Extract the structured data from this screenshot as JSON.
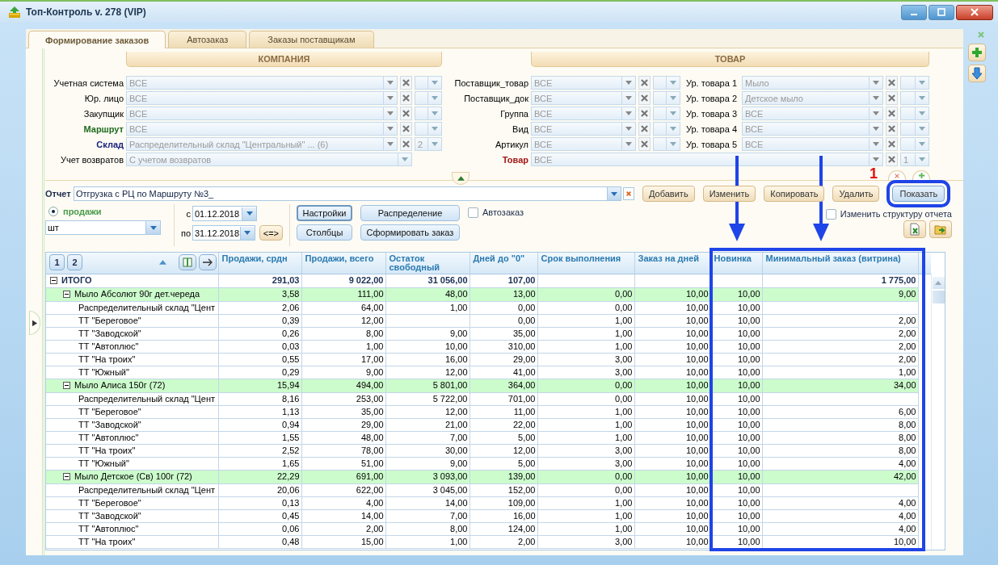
{
  "window": {
    "title": "Топ-Контроль v. 278 (VIP)"
  },
  "tabs": [
    {
      "label": "Формирование заказов",
      "selected": true
    },
    {
      "label": "Автозаказ",
      "selected": false
    },
    {
      "label": "Заказы поставщикам",
      "selected": false
    }
  ],
  "section_headers": [
    "КОМПАНИЯ",
    "ТОВАР"
  ],
  "company_filters": [
    {
      "label": "Учетная система",
      "color": "#000000",
      "value": "ВСЕ",
      "kind": "filter"
    },
    {
      "label": "Юр. лицо",
      "color": "#000000",
      "value": "ВСЕ",
      "kind": "filter"
    },
    {
      "label": "Закупщик",
      "color": "#000000",
      "value": "ВСЕ",
      "kind": "filter"
    },
    {
      "label": "Маршрут",
      "color": "#1e6b1e",
      "value": "ВСЕ",
      "kind": "filter"
    },
    {
      "label": "Склад",
      "color": "#1a237e",
      "value": "Распределительный склад \"Центральный\" ... (6)",
      "kind": "filter",
      "extra": "2"
    },
    {
      "label": "Учет возвратов",
      "color": "#000000",
      "value": "С учетом возвратов",
      "kind": "wide"
    }
  ],
  "supplier_filters": [
    {
      "label": "Поставщик_товар",
      "value": "ВСЕ"
    },
    {
      "label": "Поставщик_док",
      "value": "ВСЕ"
    },
    {
      "label": "Группа",
      "value": "ВСЕ"
    },
    {
      "label": "Вид",
      "value": "ВСЕ"
    },
    {
      "label": "Артикул",
      "value": "ВСЕ"
    }
  ],
  "product_levels": [
    {
      "label": "Ур. товара 1",
      "value": "Мыло"
    },
    {
      "label": "Ур. товара 2",
      "value": "Детское мыло"
    },
    {
      "label": "Ур. товара 3",
      "value": "ВСЕ"
    },
    {
      "label": "Ур. товара 4",
      "value": "ВСЕ"
    },
    {
      "label": "Ур. товара 5",
      "value": "ВСЕ"
    }
  ],
  "goods_filter": {
    "label": "Товар",
    "value": "ВСЕ",
    "extra": "1"
  },
  "report": {
    "label": "Отчет",
    "value": "Отгрузка с РЦ по Маршруту №3_"
  },
  "report_buttons": [
    {
      "label": "Добавить",
      "highlighted": false
    },
    {
      "label": "Изменить",
      "highlighted": false
    },
    {
      "label": "Копировать",
      "highlighted": false
    },
    {
      "label": "Удалить",
      "highlighted": false
    },
    {
      "label": "Показать",
      "highlighted": true
    }
  ],
  "mode": {
    "label": "продажи",
    "selected": true
  },
  "unit": "шт",
  "date_from": {
    "label": "с",
    "value": "01.12.2018"
  },
  "date_to": {
    "label": "по",
    "value": "31.12.2018"
  },
  "swap_button": "<=>",
  "action_buttons": [
    {
      "label": "Настройки",
      "pressed": true
    },
    {
      "label": "Распределение",
      "pressed": false
    },
    {
      "label": "Столбцы",
      "pressed": false
    },
    {
      "label": "Сформировать заказ",
      "pressed": false
    }
  ],
  "autoorder": {
    "label": "Автозаказ",
    "checked": false
  },
  "change_structure": {
    "label": "Изменить структуру отчета",
    "checked": false
  },
  "annotation_marker": "1",
  "table": {
    "view_buttons": [
      "1",
      "2"
    ],
    "columns": [
      "",
      "Продажи, срдн",
      "Продажи, всего",
      "Остаток свободный",
      "Дней до \"0\"",
      "Срок выполнения",
      "Заказ на дней",
      "Новинка",
      "Минимальный заказ (витрина)"
    ],
    "rows": [
      {
        "kind": "total",
        "expanded": true,
        "cells": [
          "ИТОГО",
          "291,03",
          "9 022,00",
          "31 056,00",
          "107,00",
          "",
          "",
          "",
          "1 775,00"
        ],
        "children": [
          {
            "kind": "group",
            "expanded": true,
            "cells": [
              "Мыло Абсолют 90г дет.череда",
              "3,58",
              "111,00",
              "48,00",
              "13,00",
              "0,00",
              "10,00",
              "10,00",
              "9,00"
            ],
            "children": [
              {
                "kind": "item",
                "cells": [
                  "Распределительный склад \"Цент",
                  "2,06",
                  "64,00",
                  "1,00",
                  "0,00",
                  "0,00",
                  "10,00",
                  "10,00",
                  ""
                ]
              },
              {
                "kind": "item",
                "cells": [
                  "ТТ  \"Береговое\"",
                  "0,39",
                  "12,00",
                  "",
                  "0,00",
                  "1,00",
                  "10,00",
                  "10,00",
                  "2,00"
                ]
              },
              {
                "kind": "item",
                "cells": [
                  "ТТ  \"Заводской\"",
                  "0,26",
                  "8,00",
                  "9,00",
                  "35,00",
                  "1,00",
                  "10,00",
                  "10,00",
                  "2,00"
                ]
              },
              {
                "kind": "item",
                "cells": [
                  "ТТ \"Автоплюс\"",
                  "0,03",
                  "1,00",
                  "10,00",
                  "310,00",
                  "1,00",
                  "10,00",
                  "10,00",
                  "2,00"
                ]
              },
              {
                "kind": "item",
                "cells": [
                  "ТТ \"На троих\"",
                  "0,55",
                  "17,00",
                  "16,00",
                  "29,00",
                  "3,00",
                  "10,00",
                  "10,00",
                  "2,00"
                ]
              },
              {
                "kind": "item",
                "cells": [
                  "ТТ \"Южный\"",
                  "0,29",
                  "9,00",
                  "12,00",
                  "41,00",
                  "3,00",
                  "10,00",
                  "10,00",
                  "1,00"
                ]
              }
            ]
          },
          {
            "kind": "group",
            "expanded": true,
            "cells": [
              "Мыло Алиса 150г (72)",
              "15,94",
              "494,00",
              "5 801,00",
              "364,00",
              "0,00",
              "10,00",
              "10,00",
              "34,00"
            ],
            "children": [
              {
                "kind": "item",
                "cells": [
                  "Распределительный склад \"Цент",
                  "8,16",
                  "253,00",
                  "5 722,00",
                  "701,00",
                  "0,00",
                  "10,00",
                  "10,00",
                  ""
                ]
              },
              {
                "kind": "item",
                "cells": [
                  "ТТ  \"Береговое\"",
                  "1,13",
                  "35,00",
                  "12,00",
                  "11,00",
                  "1,00",
                  "10,00",
                  "10,00",
                  "6,00"
                ]
              },
              {
                "kind": "item",
                "cells": [
                  "ТТ  \"Заводской\"",
                  "0,94",
                  "29,00",
                  "21,00",
                  "22,00",
                  "1,00",
                  "10,00",
                  "10,00",
                  "8,00"
                ]
              },
              {
                "kind": "item",
                "cells": [
                  "ТТ \"Автоплюс\"",
                  "1,55",
                  "48,00",
                  "7,00",
                  "5,00",
                  "1,00",
                  "10,00",
                  "10,00",
                  "8,00"
                ]
              },
              {
                "kind": "item",
                "cells": [
                  "ТТ \"На троих\"",
                  "2,52",
                  "78,00",
                  "30,00",
                  "12,00",
                  "3,00",
                  "10,00",
                  "10,00",
                  "8,00"
                ]
              },
              {
                "kind": "item",
                "cells": [
                  "ТТ \"Южный\"",
                  "1,65",
                  "51,00",
                  "9,00",
                  "5,00",
                  "3,00",
                  "10,00",
                  "10,00",
                  "4,00"
                ]
              }
            ]
          },
          {
            "kind": "group",
            "expanded": true,
            "cells": [
              "Мыло Детское (Св) 100г (72)",
              "22,29",
              "691,00",
              "3 093,00",
              "139,00",
              "0,00",
              "10,00",
              "10,00",
              "42,00"
            ],
            "children": [
              {
                "kind": "item",
                "cells": [
                  "Распределительный склад \"Цент",
                  "20,06",
                  "622,00",
                  "3 045,00",
                  "152,00",
                  "0,00",
                  "10,00",
                  "10,00",
                  ""
                ]
              },
              {
                "kind": "item",
                "cells": [
                  "ТТ  \"Береговое\"",
                  "0,13",
                  "4,00",
                  "14,00",
                  "109,00",
                  "1,00",
                  "10,00",
                  "10,00",
                  "4,00"
                ]
              },
              {
                "kind": "item",
                "cells": [
                  "ТТ  \"Заводской\"",
                  "0,45",
                  "14,00",
                  "7,00",
                  "16,00",
                  "1,00",
                  "10,00",
                  "10,00",
                  "4,00"
                ]
              },
              {
                "kind": "item",
                "cells": [
                  "ТТ \"Автоплюс\"",
                  "0,06",
                  "2,00",
                  "8,00",
                  "124,00",
                  "1,00",
                  "10,00",
                  "10,00",
                  "4,00"
                ]
              },
              {
                "kind": "item",
                "cells": [
                  "ТТ \"На троих\"",
                  "0,48",
                  "15,00",
                  "1,00",
                  "2,00",
                  "3,00",
                  "10,00",
                  "10,00",
                  "10,00"
                ]
              }
            ]
          }
        ]
      }
    ]
  }
}
